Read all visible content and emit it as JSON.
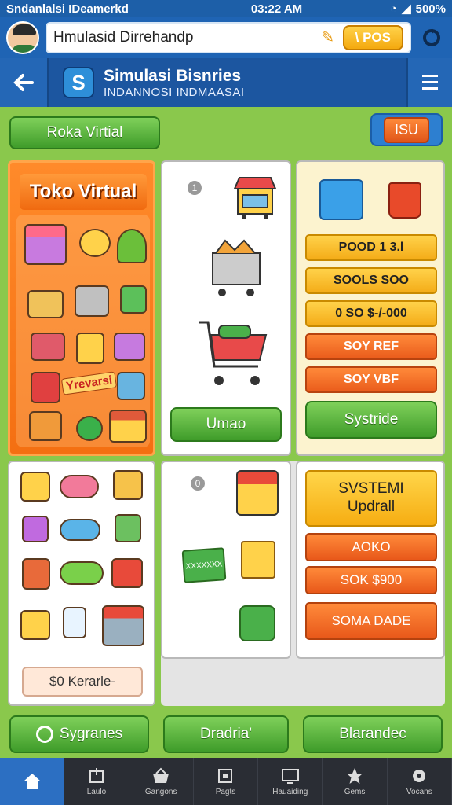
{
  "status_bar": {
    "carrier": "Sndanlalsi IDeamerkd",
    "time": "03:22 AM",
    "battery": "500%"
  },
  "search": {
    "value": "Hmulasid Dirrehandp",
    "pos_label": "\\ POS"
  },
  "header": {
    "title": "Simulasi Bisnries",
    "subtitle": "INDANNOSI INDMAASAI",
    "logo_letter": "S"
  },
  "subbar": {
    "left_button": "Roka Virtial",
    "right_button": "ISU"
  },
  "toko": {
    "title": "Toko Virtual",
    "reward_label": "Yrevarsi"
  },
  "cart_panel": {
    "number": "1",
    "button": "Umao"
  },
  "amounts": {
    "items": [
      {
        "label": "POOD 1 3.l",
        "style": "y"
      },
      {
        "label": "SOOLS SOO",
        "style": "y"
      },
      {
        "label": "0 SO $-/-000",
        "style": "y"
      },
      {
        "label": "SOY REF",
        "style": "o"
      },
      {
        "label": "SOY VBF",
        "style": "o"
      }
    ],
    "confirm_button": "Systride"
  },
  "inventory": {
    "balance_label": "$0 Kerarle-"
  },
  "shop_panel": {
    "number": "0",
    "card_label": "XXXXXXX"
  },
  "system_panel": {
    "title_line1": "SVSTEMI",
    "title_line2": "Updrall",
    "buttons": [
      "AOKO",
      "SOK $900",
      "SOMA DADE"
    ]
  },
  "actions": [
    "Sygranes",
    "Dradria'",
    "Blarandec"
  ],
  "nav": {
    "items": [
      {
        "label": "",
        "icon": "home-icon",
        "active": true
      },
      {
        "label": "Laulo",
        "icon": "box-icon"
      },
      {
        "label": "Gangons",
        "icon": "bag-icon"
      },
      {
        "label": "Pagts",
        "icon": "square-icon"
      },
      {
        "label": "Hauaiding",
        "icon": "monitor-icon"
      },
      {
        "label": "Gems",
        "icon": "star-icon"
      },
      {
        "label": "Vocans",
        "icon": "gear-icon"
      }
    ]
  },
  "colors": {
    "primary_blue": "#1f64b4",
    "green": "#3f9c2a",
    "orange": "#f46f12",
    "yellow": "#f4ac18"
  }
}
